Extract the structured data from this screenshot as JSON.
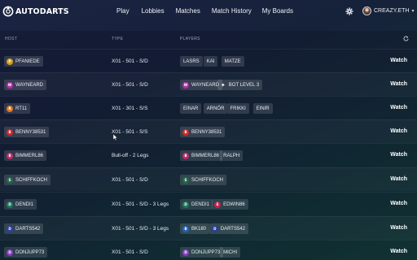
{
  "nav": {
    "logo_text": "AUTODARTS",
    "links": [
      "Play",
      "Lobbies",
      "Matches",
      "Match History",
      "My Boards"
    ],
    "user_name": "CREAZY.ETH"
  },
  "table": {
    "headers": {
      "host": "HOST",
      "type": "TYPE",
      "players": "PLAYERS"
    },
    "watch_label": "Watch",
    "rows": [
      {
        "host": {
          "name": "PFANIEDE",
          "letter": "P",
          "color": "#d4a017"
        },
        "type": "X01 - 501 - S/D",
        "players": [
          {
            "name": "LASRS"
          },
          {
            "name": "KAI"
          },
          {
            "name": "MATZE"
          }
        ]
      },
      {
        "host": {
          "name": "WAYNEARD",
          "letter": "W",
          "color": "#b32ea8"
        },
        "type": "X01 - 501 - S/D",
        "players": [
          {
            "name": "WAYNEARD",
            "letter": "W",
            "color": "#b32ea8"
          },
          {
            "name": "BOT LEVEL 3",
            "icon": "bot"
          }
        ]
      },
      {
        "host": {
          "name": "RT11",
          "letter": "R",
          "color": "#e07a1f"
        },
        "type": "X01 - 301 - S/S",
        "players": [
          {
            "name": "EINAR"
          },
          {
            "name": "ARNÖR"
          },
          {
            "name": "FRIKKI"
          },
          {
            "name": "EINIR"
          }
        ]
      },
      {
        "host": {
          "name": "BENNY38531",
          "letter": "B",
          "color": "#d6262e"
        },
        "type": "X01 - 501 - S/S",
        "players": [
          {
            "name": "BENNY38531",
            "letter": "B",
            "color": "#d6262e"
          }
        ]
      },
      {
        "host": {
          "name": "BIMMERL86",
          "letter": "B",
          "color": "#c22a6a"
        },
        "type": "Bull-off - 2 Legs",
        "players": [
          {
            "name": "BIMMERL86",
            "letter": "B",
            "color": "#c22a6a"
          },
          {
            "name": "RALPH"
          }
        ]
      },
      {
        "host": {
          "name": "SCHIFFKOCH",
          "letter": "S",
          "color": "#1f6b4a"
        },
        "type": "X01 - 501 - S/D",
        "players": [
          {
            "name": "SCHIFFKOCH",
            "letter": "S",
            "color": "#1f6b4a"
          }
        ]
      },
      {
        "host": {
          "name": "DENDI1",
          "letter": "D",
          "color": "#1f7a5c"
        },
        "type": "X01 - 501 - S/D - 3 Legs",
        "players": [
          {
            "name": "DENDI1",
            "letter": "D",
            "color": "#1f7a5c"
          },
          {
            "name": "EDWIN86",
            "letter": "E",
            "color": "#c4244f"
          }
        ]
      },
      {
        "host": {
          "name": "DARTS542",
          "letter": "D",
          "color": "#2a3f9e"
        },
        "type": "X01 - 501 - S/D - 3 Legs",
        "players": [
          {
            "name": "BK180",
            "letter": "B",
            "color": "#2563b8"
          },
          {
            "name": "DARTS542",
            "letter": "D",
            "color": "#2a3f9e"
          }
        ]
      },
      {
        "host": {
          "name": "DONJUPP73",
          "letter": "D",
          "color": "#8a3fbf"
        },
        "type": "X01 - 501 - S/D",
        "players": [
          {
            "name": "DONJUPP73",
            "letter": "D",
            "color": "#8a3fbf"
          },
          {
            "name": "MICHI"
          }
        ]
      }
    ]
  }
}
